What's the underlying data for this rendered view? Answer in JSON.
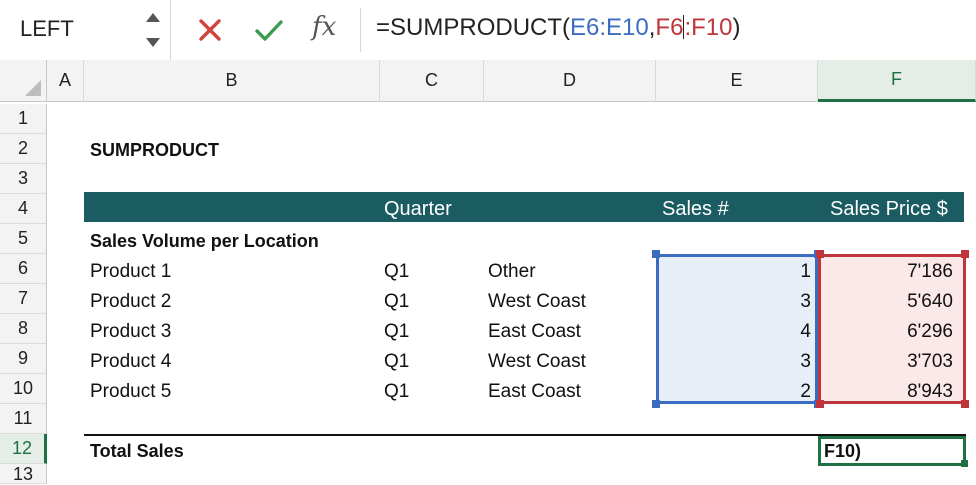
{
  "formula_bar": {
    "name_box": "LEFT",
    "fx_label": "fx",
    "formula_prefix": "=SUMPRODUCT(",
    "ref1": "E6:E10",
    "comma": ",",
    "ref2_part1": "F6",
    "ref2_part2": ":F10",
    "formula_suffix": ")"
  },
  "columns": [
    "A",
    "B",
    "C",
    "D",
    "E",
    "F"
  ],
  "rows": [
    "1",
    "2",
    "3",
    "4",
    "5",
    "6",
    "7",
    "8",
    "9",
    "10",
    "11",
    "12",
    "13"
  ],
  "sheet": {
    "title": "SUMPRODUCT",
    "header": {
      "quarter": "Quarter",
      "sales_num": "Sales #",
      "sales_price": "Sales Price $"
    },
    "section_label": "Sales Volume per Location",
    "data_rows": [
      {
        "product": "Product 1",
        "quarter": "Q1",
        "location": "Other",
        "sales": "1",
        "price": "7'186"
      },
      {
        "product": "Product 2",
        "quarter": "Q1",
        "location": "West Coast",
        "sales": "3",
        "price": "5'640"
      },
      {
        "product": "Product 3",
        "quarter": "Q1",
        "location": "East Coast",
        "sales": "4",
        "price": "6'296"
      },
      {
        "product": "Product 4",
        "quarter": "Q1",
        "location": "West Coast",
        "sales": "3",
        "price": "3'703"
      },
      {
        "product": "Product 5",
        "quarter": "Q1",
        "location": "East Coast",
        "sales": "2",
        "price": "8'943"
      }
    ],
    "total_label": "Total Sales",
    "active_cell_text": "F10)"
  },
  "colors": {
    "header_band": "#1a5c61",
    "ref_blue": "#3a6dc2",
    "ref_red": "#c0343c",
    "selection_green": "#1e7145"
  }
}
